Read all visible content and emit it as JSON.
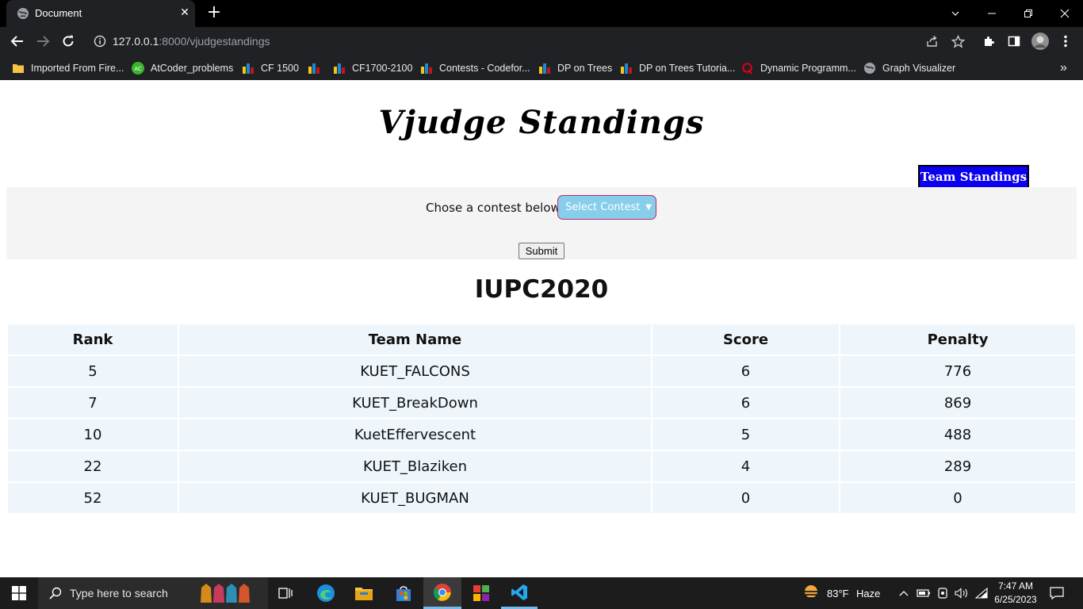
{
  "browser": {
    "tab_title": "Document",
    "url_host": "127.0.0.1",
    "url_path": ":8000/vjudgestandings",
    "bookmarks": [
      {
        "label": "Imported From Fire...",
        "icon": "folder-icon"
      },
      {
        "label": "AtCoder_problems",
        "icon": "atcoder-icon"
      },
      {
        "label": "CF 1500",
        "icon": "bar-chart-icon"
      },
      {
        "label": "CF1700-2100",
        "icon": "bar-chart-icon"
      },
      {
        "label": "Contests - Codefor...",
        "icon": "bar-chart-icon"
      },
      {
        "label": "DP on Trees",
        "icon": "bar-chart-icon"
      },
      {
        "label": "DP on Trees Tutoria...",
        "icon": "bar-chart-icon"
      },
      {
        "label": "Dynamic Programm...",
        "icon": "quora-icon"
      },
      {
        "label": "Graph Visualizer",
        "icon": "globe-icon"
      }
    ],
    "more_bookmarks": "»"
  },
  "page": {
    "heading": "Vjudge Standings",
    "team_standings_button": "Team Standings",
    "form": {
      "label": "Chose a contest below",
      "select_value": "Select Contest",
      "submit_label": "Submit"
    },
    "contest_title": "IUPC2020",
    "table": {
      "headers": [
        "Rank",
        "Team Name",
        "Score",
        "Penalty"
      ],
      "rows": [
        [
          "5",
          "KUET_FALCONS",
          "6",
          "776"
        ],
        [
          "7",
          "KUET_BreakDown",
          "6",
          "869"
        ],
        [
          "10",
          "KuetEffervescent",
          "5",
          "488"
        ],
        [
          "22",
          "KUET_Blaziken",
          "4",
          "289"
        ],
        [
          "52",
          "KUET_BUGMAN",
          "0",
          "0"
        ]
      ]
    }
  },
  "taskbar": {
    "search_placeholder": "Type here to search",
    "weather_temp": "83°F",
    "weather_desc": "Haze",
    "time": "7:47 AM",
    "date": "6/25/2023"
  }
}
